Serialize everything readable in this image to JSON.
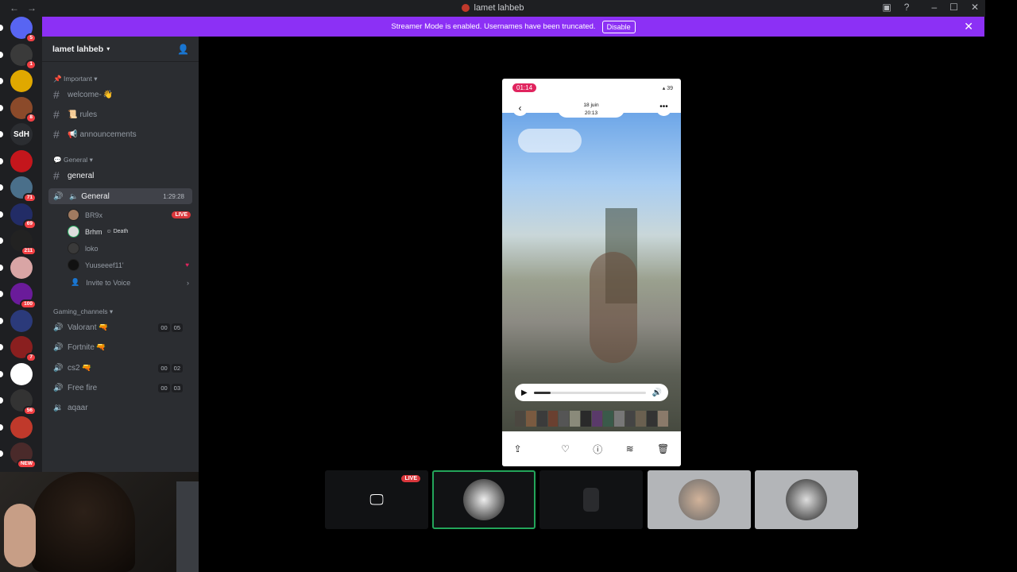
{
  "window": {
    "title": "lamet lahbeb"
  },
  "banner": {
    "text": "Streamer Mode is enabled. Usernames have been truncated.",
    "disable_label": "Disable"
  },
  "guilds": [
    {
      "label": "",
      "badge": "5",
      "color": "#5865f2"
    },
    {
      "label": "",
      "badge": "1",
      "color": "#3a3a3a"
    },
    {
      "label": "",
      "badge": "",
      "color": "#e0a800"
    },
    {
      "label": "",
      "badge": "8",
      "color": "#8b4a2a"
    },
    {
      "label": "SdH",
      "badge": "",
      "color": "#2b2d31"
    },
    {
      "label": "",
      "badge": "",
      "color": "#c4161c"
    },
    {
      "label": "",
      "badge": "71",
      "color": "#4a6f8a"
    },
    {
      "label": "",
      "badge": "69",
      "color": "#222c66"
    },
    {
      "label": "",
      "badge": "211",
      "color": "#222"
    },
    {
      "label": "",
      "badge": "",
      "color": "#d9a5a5"
    },
    {
      "label": "",
      "badge": "100",
      "color": "#6a1b9a"
    },
    {
      "label": "",
      "badge": "",
      "color": "#2b3a7a"
    },
    {
      "label": "",
      "badge": "7",
      "color": "#8a1f1f"
    },
    {
      "label": "",
      "badge": "",
      "color": "#fff"
    },
    {
      "label": "",
      "badge": "56",
      "color": "#333"
    },
    {
      "label": "",
      "badge": "",
      "color": "#c0392b"
    },
    {
      "label": "",
      "badge": "NEW",
      "color": "#4a2a2a"
    }
  ],
  "server": {
    "name": "lamet lahbeb"
  },
  "categories": {
    "important": "Important",
    "general": "General",
    "gaming": "Gaming_channels"
  },
  "channels": {
    "welcome": "welcome-",
    "rules": "rules",
    "announcements": "announcements",
    "general_text": "general",
    "general_voice": "General",
    "general_voice_time": "1:29:28",
    "valorant": "Valorant",
    "valorant_count": [
      "00",
      "05"
    ],
    "fortnite": "Fortnite",
    "cs2": "cs2",
    "cs2_count": [
      "00",
      "02"
    ],
    "freefire": "Free fire",
    "freefire_count": [
      "00",
      "03"
    ],
    "aqaar": "aqaar"
  },
  "voice_users": [
    {
      "name": "BR9x",
      "live": "LIVE",
      "extra": ""
    },
    {
      "name": "Brhm",
      "live": "",
      "extra": "Death"
    },
    {
      "name": "loko",
      "live": "",
      "extra": ""
    },
    {
      "name": "Yuuseeef11'",
      "live": "",
      "extra": ""
    }
  ],
  "invite_label": "Invite to Voice",
  "phone": {
    "clock": "01:14",
    "battery": "39",
    "date_line1": "18 juin",
    "date_line2": "20:13",
    "video_progress": 0.15
  },
  "tiles": {
    "live_label": "LIVE"
  }
}
